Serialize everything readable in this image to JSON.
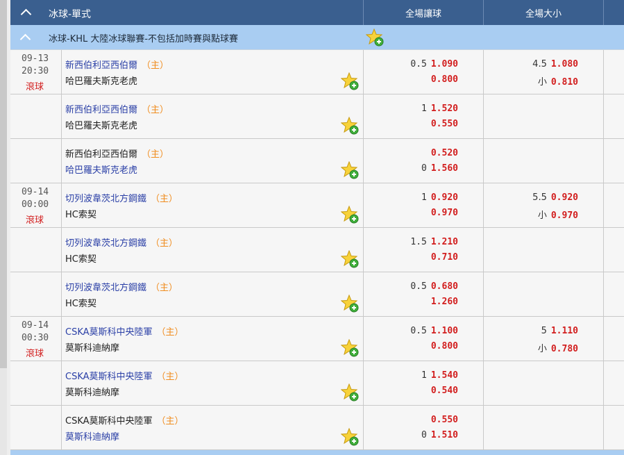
{
  "header": {
    "title": "冰球-單式",
    "col_handicap": "全場讓球",
    "col_overunder": "全場大小"
  },
  "league": {
    "name": "冰球-KHL 大陸冰球聯賽-不包括加時賽與點球賽"
  },
  "home_marker": "（主）",
  "live_label": "滾球",
  "rows": [
    {
      "date": "09-13",
      "time": "20:30",
      "live": true,
      "team1": "新西伯利亞西伯爾",
      "team1_color": "blue",
      "team1_home": true,
      "team2": "哈巴羅夫斯克老虎",
      "team2_color": "black",
      "hc1_line": "0.5",
      "hc1_odd": "1.090",
      "hc2_line": "",
      "hc2_odd": "0.800",
      "ou1_line": "4.5",
      "ou1_odd": "1.080",
      "ou2_line": "小",
      "ou2_odd": "0.810"
    },
    {
      "date": "",
      "time": "",
      "live": false,
      "team1": "新西伯利亞西伯爾",
      "team1_color": "blue",
      "team1_home": true,
      "team2": "哈巴羅夫斯克老虎",
      "team2_color": "black",
      "hc1_line": "1",
      "hc1_odd": "1.520",
      "hc2_line": "",
      "hc2_odd": "0.550",
      "ou1_line": "",
      "ou1_odd": "",
      "ou2_line": "",
      "ou2_odd": ""
    },
    {
      "date": "",
      "time": "",
      "live": false,
      "team1": "新西伯利亞西伯爾",
      "team1_color": "black",
      "team1_home": true,
      "team2": "哈巴羅夫斯克老虎",
      "team2_color": "blue",
      "hc1_line": "",
      "hc1_odd": "0.520",
      "hc2_line": "0",
      "hc2_odd": "1.560",
      "ou1_line": "",
      "ou1_odd": "",
      "ou2_line": "",
      "ou2_odd": ""
    },
    {
      "date": "09-14",
      "time": "00:00",
      "live": true,
      "team1": "切列波韋茨北方鋼鐵",
      "team1_color": "blue",
      "team1_home": true,
      "team2": "HC索契",
      "team2_color": "black",
      "hc1_line": "1",
      "hc1_odd": "0.920",
      "hc2_line": "",
      "hc2_odd": "0.970",
      "ou1_line": "5.5",
      "ou1_odd": "0.920",
      "ou2_line": "小",
      "ou2_odd": "0.970"
    },
    {
      "date": "",
      "time": "",
      "live": false,
      "team1": "切列波韋茨北方鋼鐵",
      "team1_color": "blue",
      "team1_home": true,
      "team2": "HC索契",
      "team2_color": "black",
      "hc1_line": "1.5",
      "hc1_odd": "1.210",
      "hc2_line": "",
      "hc2_odd": "0.710",
      "ou1_line": "",
      "ou1_odd": "",
      "ou2_line": "",
      "ou2_odd": ""
    },
    {
      "date": "",
      "time": "",
      "live": false,
      "team1": "切列波韋茨北方鋼鐵",
      "team1_color": "blue",
      "team1_home": true,
      "team2": "HC索契",
      "team2_color": "black",
      "hc1_line": "0.5",
      "hc1_odd": "0.680",
      "hc2_line": "",
      "hc2_odd": "1.260",
      "ou1_line": "",
      "ou1_odd": "",
      "ou2_line": "",
      "ou2_odd": ""
    },
    {
      "date": "09-14",
      "time": "00:30",
      "live": true,
      "team1": "CSKA莫斯科中央陸軍",
      "team1_color": "blue",
      "team1_home": true,
      "team2": "莫斯科迪納摩",
      "team2_color": "black",
      "hc1_line": "0.5",
      "hc1_odd": "1.100",
      "hc2_line": "",
      "hc2_odd": "0.800",
      "ou1_line": "5",
      "ou1_odd": "1.110",
      "ou2_line": "小",
      "ou2_odd": "0.780"
    },
    {
      "date": "",
      "time": "",
      "live": false,
      "team1": "CSKA莫斯科中央陸軍",
      "team1_color": "blue",
      "team1_home": true,
      "team2": "莫斯科迪納摩",
      "team2_color": "black",
      "hc1_line": "1",
      "hc1_odd": "1.540",
      "hc2_line": "",
      "hc2_odd": "0.540",
      "ou1_line": "",
      "ou1_odd": "",
      "ou2_line": "",
      "ou2_odd": ""
    },
    {
      "date": "",
      "time": "",
      "live": false,
      "team1": "CSKA莫斯科中央陸軍",
      "team1_color": "black",
      "team1_home": true,
      "team2": "莫斯科迪納摩",
      "team2_color": "blue",
      "hc1_line": "",
      "hc1_odd": "0.550",
      "hc2_line": "0",
      "hc2_odd": "1.510",
      "ou1_line": "",
      "ou1_odd": "",
      "ou2_line": "",
      "ou2_odd": ""
    }
  ],
  "colors": {
    "header_bg": "#3a5f8f",
    "league_bg": "#a9cdf2",
    "odds_red": "#d21e1e",
    "team_blue": "#2a3fa6",
    "home_orange": "#f08c1e"
  },
  "icons": {
    "collapse": "chevron-up-icon",
    "favorite": "star-add-icon"
  }
}
